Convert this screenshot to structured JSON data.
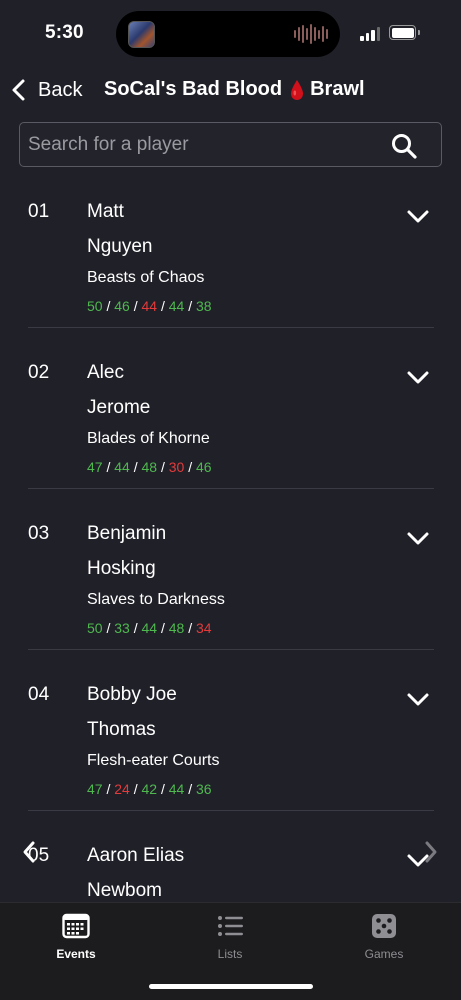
{
  "status_bar": {
    "time": "5:30",
    "icons": [
      "island-thumbnail",
      "audio-wave-icon",
      "signal-icon",
      "battery-icon"
    ]
  },
  "nav": {
    "back_label": "Back",
    "title_part1": "SoCal's Bad Blood",
    "title_icon": "blood-drop-icon",
    "title_part2": "Brawl"
  },
  "search": {
    "placeholder": "Search for a player",
    "value": ""
  },
  "players": [
    {
      "rank": "01",
      "first_name": "Matt",
      "last_name": "Nguyen",
      "faction": "Beasts of Chaos",
      "scores": [
        {
          "value": "50",
          "result": "win"
        },
        {
          "value": "46",
          "result": "win"
        },
        {
          "value": "44",
          "result": "loss"
        },
        {
          "value": "44",
          "result": "win"
        },
        {
          "value": "38",
          "result": "win"
        }
      ]
    },
    {
      "rank": "02",
      "first_name": "Alec",
      "last_name": "Jerome",
      "faction": "Blades of Khorne",
      "scores": [
        {
          "value": "47",
          "result": "win"
        },
        {
          "value": "44",
          "result": "win"
        },
        {
          "value": "48",
          "result": "win"
        },
        {
          "value": "30",
          "result": "loss"
        },
        {
          "value": "46",
          "result": "win"
        }
      ]
    },
    {
      "rank": "03",
      "first_name": "Benjamin",
      "last_name": "Hosking",
      "faction": "Slaves to Darkness",
      "scores": [
        {
          "value": "50",
          "result": "win"
        },
        {
          "value": "33",
          "result": "win"
        },
        {
          "value": "44",
          "result": "win"
        },
        {
          "value": "48",
          "result": "win"
        },
        {
          "value": "34",
          "result": "loss"
        }
      ]
    },
    {
      "rank": "04",
      "first_name": "Bobby Joe",
      "last_name": "Thomas",
      "faction": "Flesh-eater Courts",
      "scores": [
        {
          "value": "47",
          "result": "win"
        },
        {
          "value": "24",
          "result": "loss"
        },
        {
          "value": "42",
          "result": "win"
        },
        {
          "value": "44",
          "result": "win"
        },
        {
          "value": "36",
          "result": "win"
        }
      ]
    },
    {
      "rank": "05",
      "first_name": "Aaron Elias",
      "last_name": "Newbom",
      "faction": "",
      "scores": []
    }
  ],
  "score_separator": " / ",
  "colors": {
    "background": "#202029",
    "win": "#4fb84f",
    "loss": "#e23b3b",
    "blood_drop": "#d0101a"
  },
  "tabs": [
    {
      "label": "Events",
      "icon": "calendar-icon",
      "active": true
    },
    {
      "label": "Lists",
      "icon": "list-icon",
      "active": false
    },
    {
      "label": "Games",
      "icon": "dice-icon",
      "active": false
    }
  ]
}
